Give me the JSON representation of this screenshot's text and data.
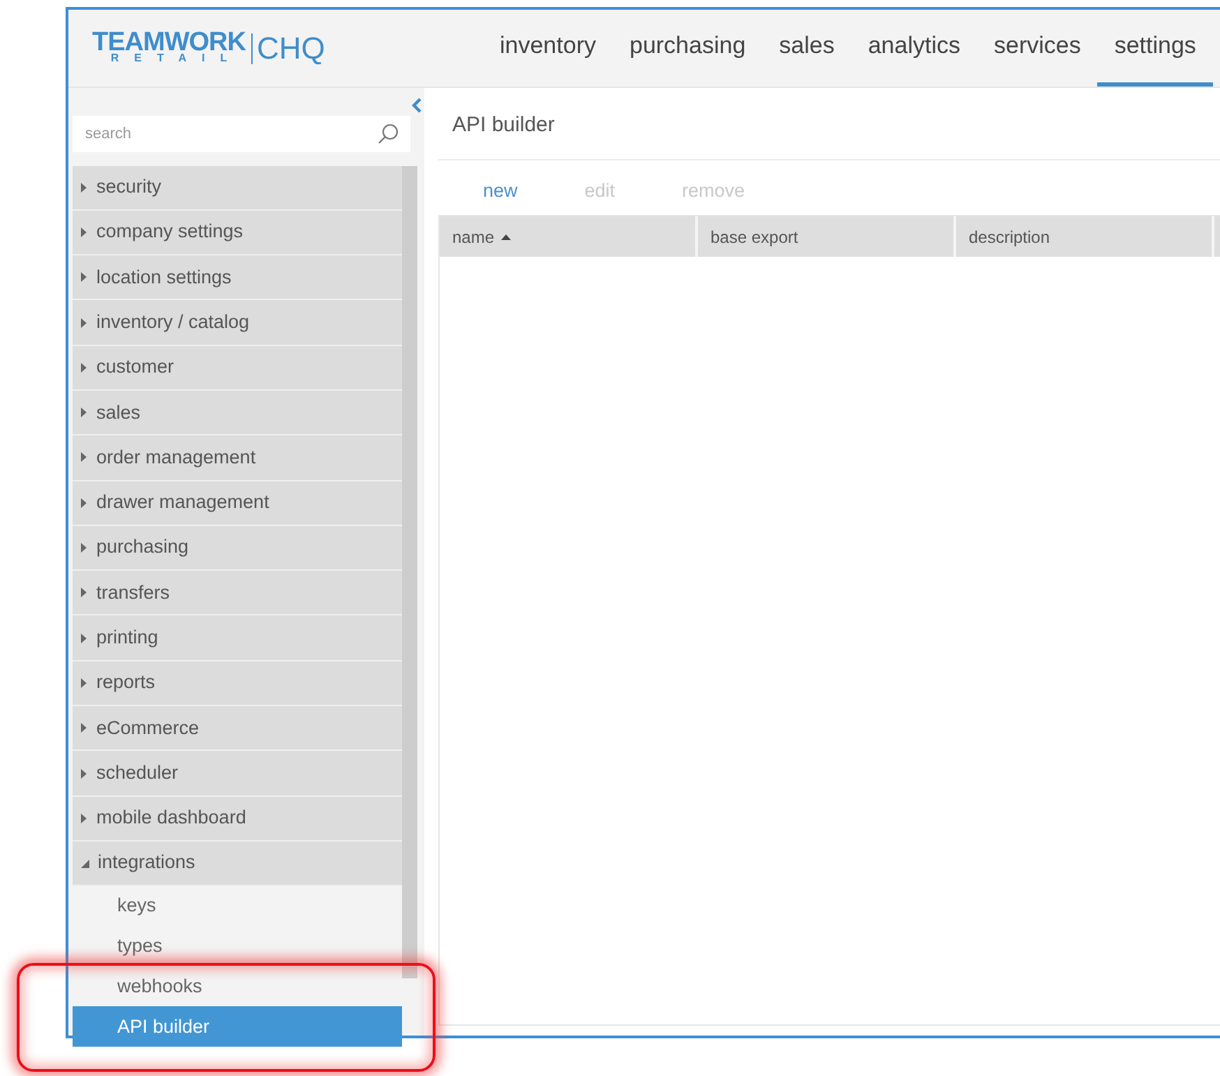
{
  "logo": {
    "brand": "TEAMWORK",
    "sub": "RETAIL",
    "product": "CHQ"
  },
  "nav": [
    {
      "label": "inventory",
      "selected": false
    },
    {
      "label": "purchasing",
      "selected": false
    },
    {
      "label": "sales",
      "selected": false
    },
    {
      "label": "analytics",
      "selected": false
    },
    {
      "label": "services",
      "selected": false
    },
    {
      "label": "settings",
      "selected": true
    }
  ],
  "sidebar": {
    "search": {
      "placeholder": "search"
    },
    "items": [
      {
        "label": "security",
        "expanded": false
      },
      {
        "label": "company settings",
        "expanded": false
      },
      {
        "label": "location settings",
        "expanded": false
      },
      {
        "label": "inventory / catalog",
        "expanded": false
      },
      {
        "label": "customer",
        "expanded": false
      },
      {
        "label": "sales",
        "expanded": false
      },
      {
        "label": "order management",
        "expanded": false
      },
      {
        "label": "drawer management",
        "expanded": false
      },
      {
        "label": "purchasing",
        "expanded": false
      },
      {
        "label": "transfers",
        "expanded": false
      },
      {
        "label": "printing",
        "expanded": false
      },
      {
        "label": "reports",
        "expanded": false
      },
      {
        "label": "eCommerce",
        "expanded": false
      },
      {
        "label": "scheduler",
        "expanded": false
      },
      {
        "label": "mobile dashboard",
        "expanded": false
      },
      {
        "label": "integrations",
        "expanded": true,
        "children": [
          {
            "label": "keys",
            "selected": false
          },
          {
            "label": "types",
            "selected": false
          },
          {
            "label": "webhooks",
            "selected": false
          },
          {
            "label": "API builder",
            "selected": true
          }
        ]
      }
    ]
  },
  "page": {
    "title": "API builder",
    "actions": [
      {
        "label": "new",
        "disabled": false
      },
      {
        "label": "edit",
        "disabled": true
      },
      {
        "label": "remove",
        "disabled": true
      }
    ],
    "table": {
      "columns": [
        {
          "label": "name",
          "sort_ascending": true
        },
        {
          "label": "base export"
        },
        {
          "label": "description"
        }
      ]
    }
  }
}
